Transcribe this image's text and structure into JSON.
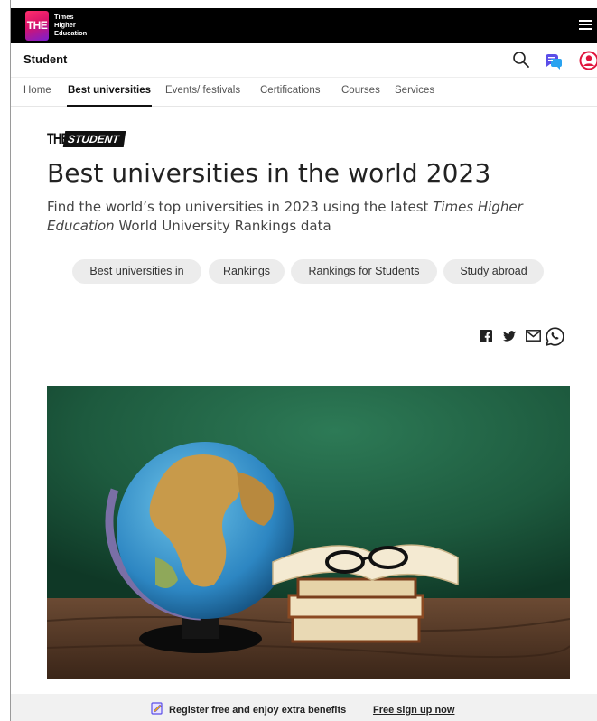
{
  "header": {
    "logo_mark": "THE",
    "logo_lines": [
      "Times",
      "Higher",
      "Education"
    ],
    "section_label": "Student"
  },
  "nav": {
    "items": [
      {
        "label": "Home"
      },
      {
        "label": "Best universities",
        "active": true
      },
      {
        "label": "Events/ festivals"
      },
      {
        "label": "Certifications"
      },
      {
        "label": "Courses"
      },
      {
        "label": "Services"
      }
    ]
  },
  "brand": {
    "the": "THE",
    "student": "STUDENT"
  },
  "article": {
    "title": "Best universities in the world 2023",
    "subtitle_part1": "Find the world’s top universities in 2023 using the latest ",
    "subtitle_italic1": "Times Higher Education",
    "subtitle_part2": " World University Rankings data"
  },
  "chips": [
    {
      "label": "Best universities in"
    },
    {
      "label": "Rankings"
    },
    {
      "label": "Rankings for Students"
    },
    {
      "label": "Study abroad"
    }
  ],
  "share_icons": [
    "facebook-icon",
    "twitter-icon",
    "email-icon",
    "whatsapp-icon"
  ],
  "footer": {
    "text": "Register free and enjoy extra benefits",
    "link": "Free sign up now"
  },
  "colors": {
    "accent_pink": "#d8136a",
    "accent_purple": "#7a1fd1",
    "chat_blue": "#5b4ee8",
    "user_red": "#e0143c"
  }
}
